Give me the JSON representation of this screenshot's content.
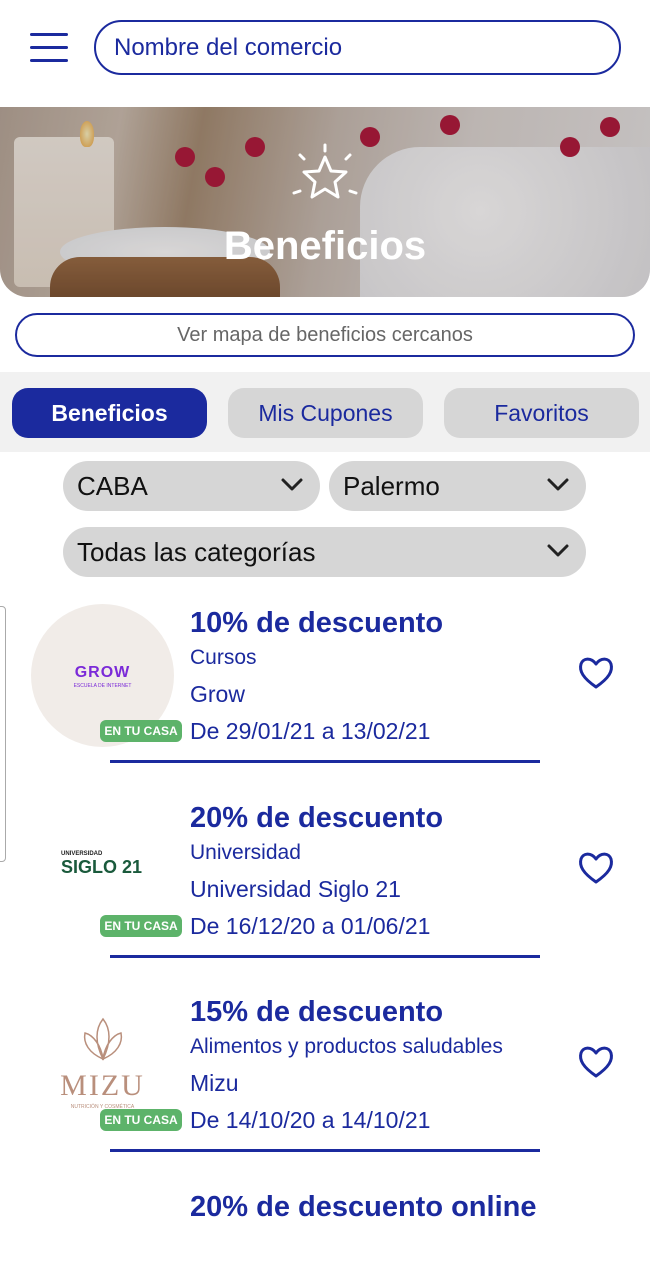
{
  "header": {
    "search_placeholder": "Nombre del comercio"
  },
  "hero": {
    "title": "Beneficios"
  },
  "map_link": "Ver mapa de beneficios cercanos",
  "tabs": [
    {
      "label": "Beneficios",
      "active": true
    },
    {
      "label": "Mis Cupones",
      "active": false
    },
    {
      "label": "Favoritos",
      "active": false
    }
  ],
  "filters": {
    "province": "CABA",
    "neighborhood": "Palermo",
    "category": "Todas las categorías"
  },
  "benefits": [
    {
      "title": "10% de descuento",
      "category": "Cursos",
      "merchant": "Grow",
      "dates": "De 29/01/21 a 13/02/21",
      "badge": "EN TU CASA",
      "logo_text": "GROW",
      "logo_sub": "ESCUELA DE INTERNET"
    },
    {
      "title": "20% de descuento",
      "category": "Universidad",
      "merchant": "Universidad Siglo 21",
      "dates": "De 16/12/20 a 01/06/21",
      "badge": "EN TU CASA",
      "logo_text": "SIGLO 21",
      "logo_sub": "UNIVERSIDAD"
    },
    {
      "title": "15% de descuento",
      "category": "Alimentos y productos saludables",
      "merchant": "Mizu",
      "dates": "De 14/10/20 a 14/10/21",
      "badge": "EN TU CASA",
      "logo_text": "MIZU",
      "logo_sub": "NUTRICIÓN Y COSMÉTICA"
    },
    {
      "title": "20% de descuento online"
    }
  ],
  "colors": {
    "primary": "#1b2a9e",
    "badge": "#5db36a",
    "pill": "#d6d6d6"
  }
}
